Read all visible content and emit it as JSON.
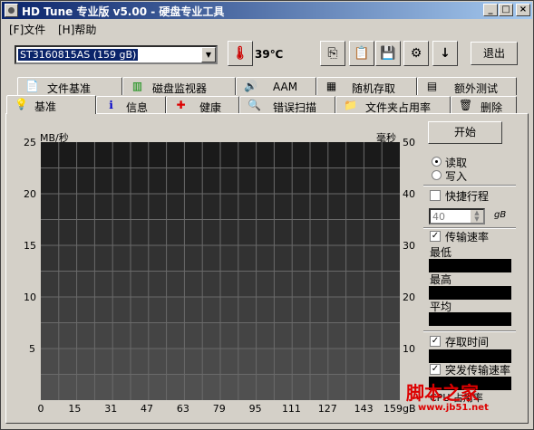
{
  "window": {
    "title": "HD Tune 专业版 v5.00 - 硬盘专业工具"
  },
  "title_buttons": {
    "minimize": "_",
    "maximize": "□",
    "close": "×"
  },
  "menu": {
    "file": "[F]文件",
    "help": "[H]帮助"
  },
  "toolbar": {
    "drive": "ST3160815AS (159 gB)",
    "temperature": "39℃",
    "exit_label": "退出",
    "icons": [
      "thermometer-icon",
      "copy-icon",
      "paste-icon",
      "save-icon",
      "key-icon",
      "down-arrow-icon"
    ]
  },
  "tabs_row1": [
    {
      "label": "文件基准",
      "icon": "file-benchmark-icon"
    },
    {
      "label": "磁盘监视器",
      "icon": "disk-monitor-icon"
    },
    {
      "label": "AAM",
      "icon": "speaker-icon"
    },
    {
      "label": "随机存取",
      "icon": "random-access-icon"
    },
    {
      "label": "额外测试",
      "icon": "extra-tests-icon"
    }
  ],
  "tabs_row2": [
    {
      "label": "基准",
      "icon": "benchmark-icon"
    },
    {
      "label": "信息",
      "icon": "info-icon"
    },
    {
      "label": "健康",
      "icon": "health-icon"
    },
    {
      "label": "错误扫描",
      "icon": "error-scan-icon"
    },
    {
      "label": "文件夹占用率",
      "icon": "folder-usage-icon"
    },
    {
      "label": "删除",
      "icon": "trash-icon"
    }
  ],
  "chart_data": {
    "type": "line",
    "ylabel_left": "MB/秒",
    "ylabel_right": "毫秒",
    "left_ticks": [
      "25",
      "20",
      "15",
      "10",
      "5"
    ],
    "right_ticks": [
      "50",
      "40",
      "30",
      "20",
      "10"
    ],
    "x_ticks": [
      "0",
      "15",
      "31",
      "47",
      "63",
      "79",
      "95",
      "111",
      "127",
      "143",
      "159gB"
    ],
    "ylim_left": [
      0,
      25
    ],
    "ylim_right": [
      0,
      50
    ],
    "xlim": [
      0,
      159
    ],
    "grid": true,
    "series": []
  },
  "controls": {
    "start": "开始",
    "read": "读取",
    "write": "写入",
    "short_stroke": "快捷行程",
    "short_stroke_value": "40",
    "short_stroke_unit": "gB",
    "transfer_rate": "传输速率",
    "min": "最低",
    "max": "最高",
    "avg": "平均",
    "access_time": "存取时间",
    "burst_rate": "突发传输速率",
    "cpu_usage": "CPU 占用率"
  },
  "watermark": {
    "text": "脚本之家",
    "url": "www.jb51.net"
  }
}
